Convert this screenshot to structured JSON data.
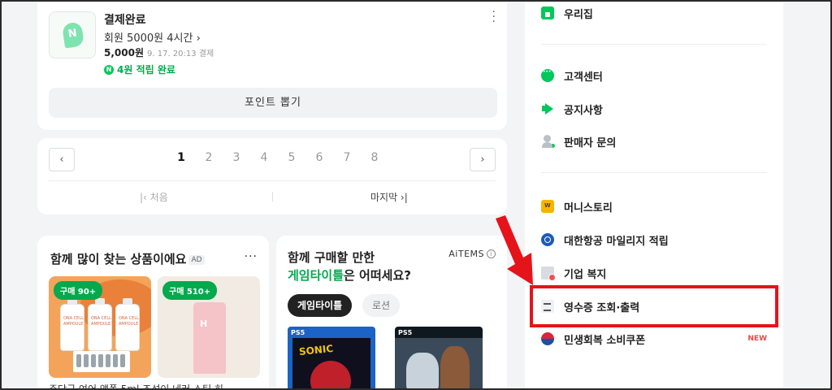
{
  "payment": {
    "title": "결제완료",
    "detail": "회원 5000원 4시간",
    "amount": "5,000원",
    "date": "9. 17. 20:13 결제",
    "point_badge": "N",
    "point_text": "4원 적립 완료",
    "earn_button": "포인트 뽑기"
  },
  "pagination": {
    "prev": "‹",
    "next": "›",
    "pages": [
      "1",
      "2",
      "3",
      "4",
      "5",
      "6",
      "7",
      "8"
    ],
    "current": "1",
    "first": "|‹ 처음",
    "last": "마지막 ›|"
  },
  "recommend": {
    "title": "함께 많이 찾는 상품이에요",
    "ad": "AD",
    "more": "···",
    "products": [
      {
        "badge": "구매 90+",
        "bottle_text": "ONA CELL AMPOULE"
      },
      {
        "badge": "구매 510+"
      }
    ],
    "caption": "주단군 여어 앰폴 5ml 조성이 네러 스팀 히"
  },
  "game": {
    "title_line1": "함께 구매할 만한",
    "title_highlight": "게임타이틀",
    "title_rest": "은 어떠세요?",
    "brand": "AiTEMS",
    "info": "i",
    "chips": [
      "게임타이틀",
      "로션"
    ],
    "covers": [
      {
        "platform": "PS5",
        "art_text": "SONIC"
      },
      {
        "platform": "PS5"
      }
    ]
  },
  "menu": {
    "items": [
      {
        "label": "우리집",
        "icon": "house-icon"
      },
      {
        "label": "고객센터",
        "icon": "chat-bubble-icon"
      },
      {
        "label": "공지사항",
        "icon": "megaphone-icon"
      },
      {
        "label": "판매자 문의",
        "icon": "person-icon"
      },
      {
        "label": "머니스토리",
        "icon": "wallet-icon"
      },
      {
        "label": "대한항공 마일리지 적립",
        "icon": "korean-air-icon"
      },
      {
        "label": "기업 복지",
        "icon": "building-icon"
      },
      {
        "label": "영수증 조회·출력",
        "icon": "receipt-icon"
      },
      {
        "label": "민생회복 소비쿠폰",
        "icon": "taegeuk-icon"
      }
    ],
    "new_badge": "NEW"
  },
  "colors": {
    "naver_green": "#03c75a",
    "highlight_red": "#e5141a",
    "new_red": "#f04848"
  }
}
